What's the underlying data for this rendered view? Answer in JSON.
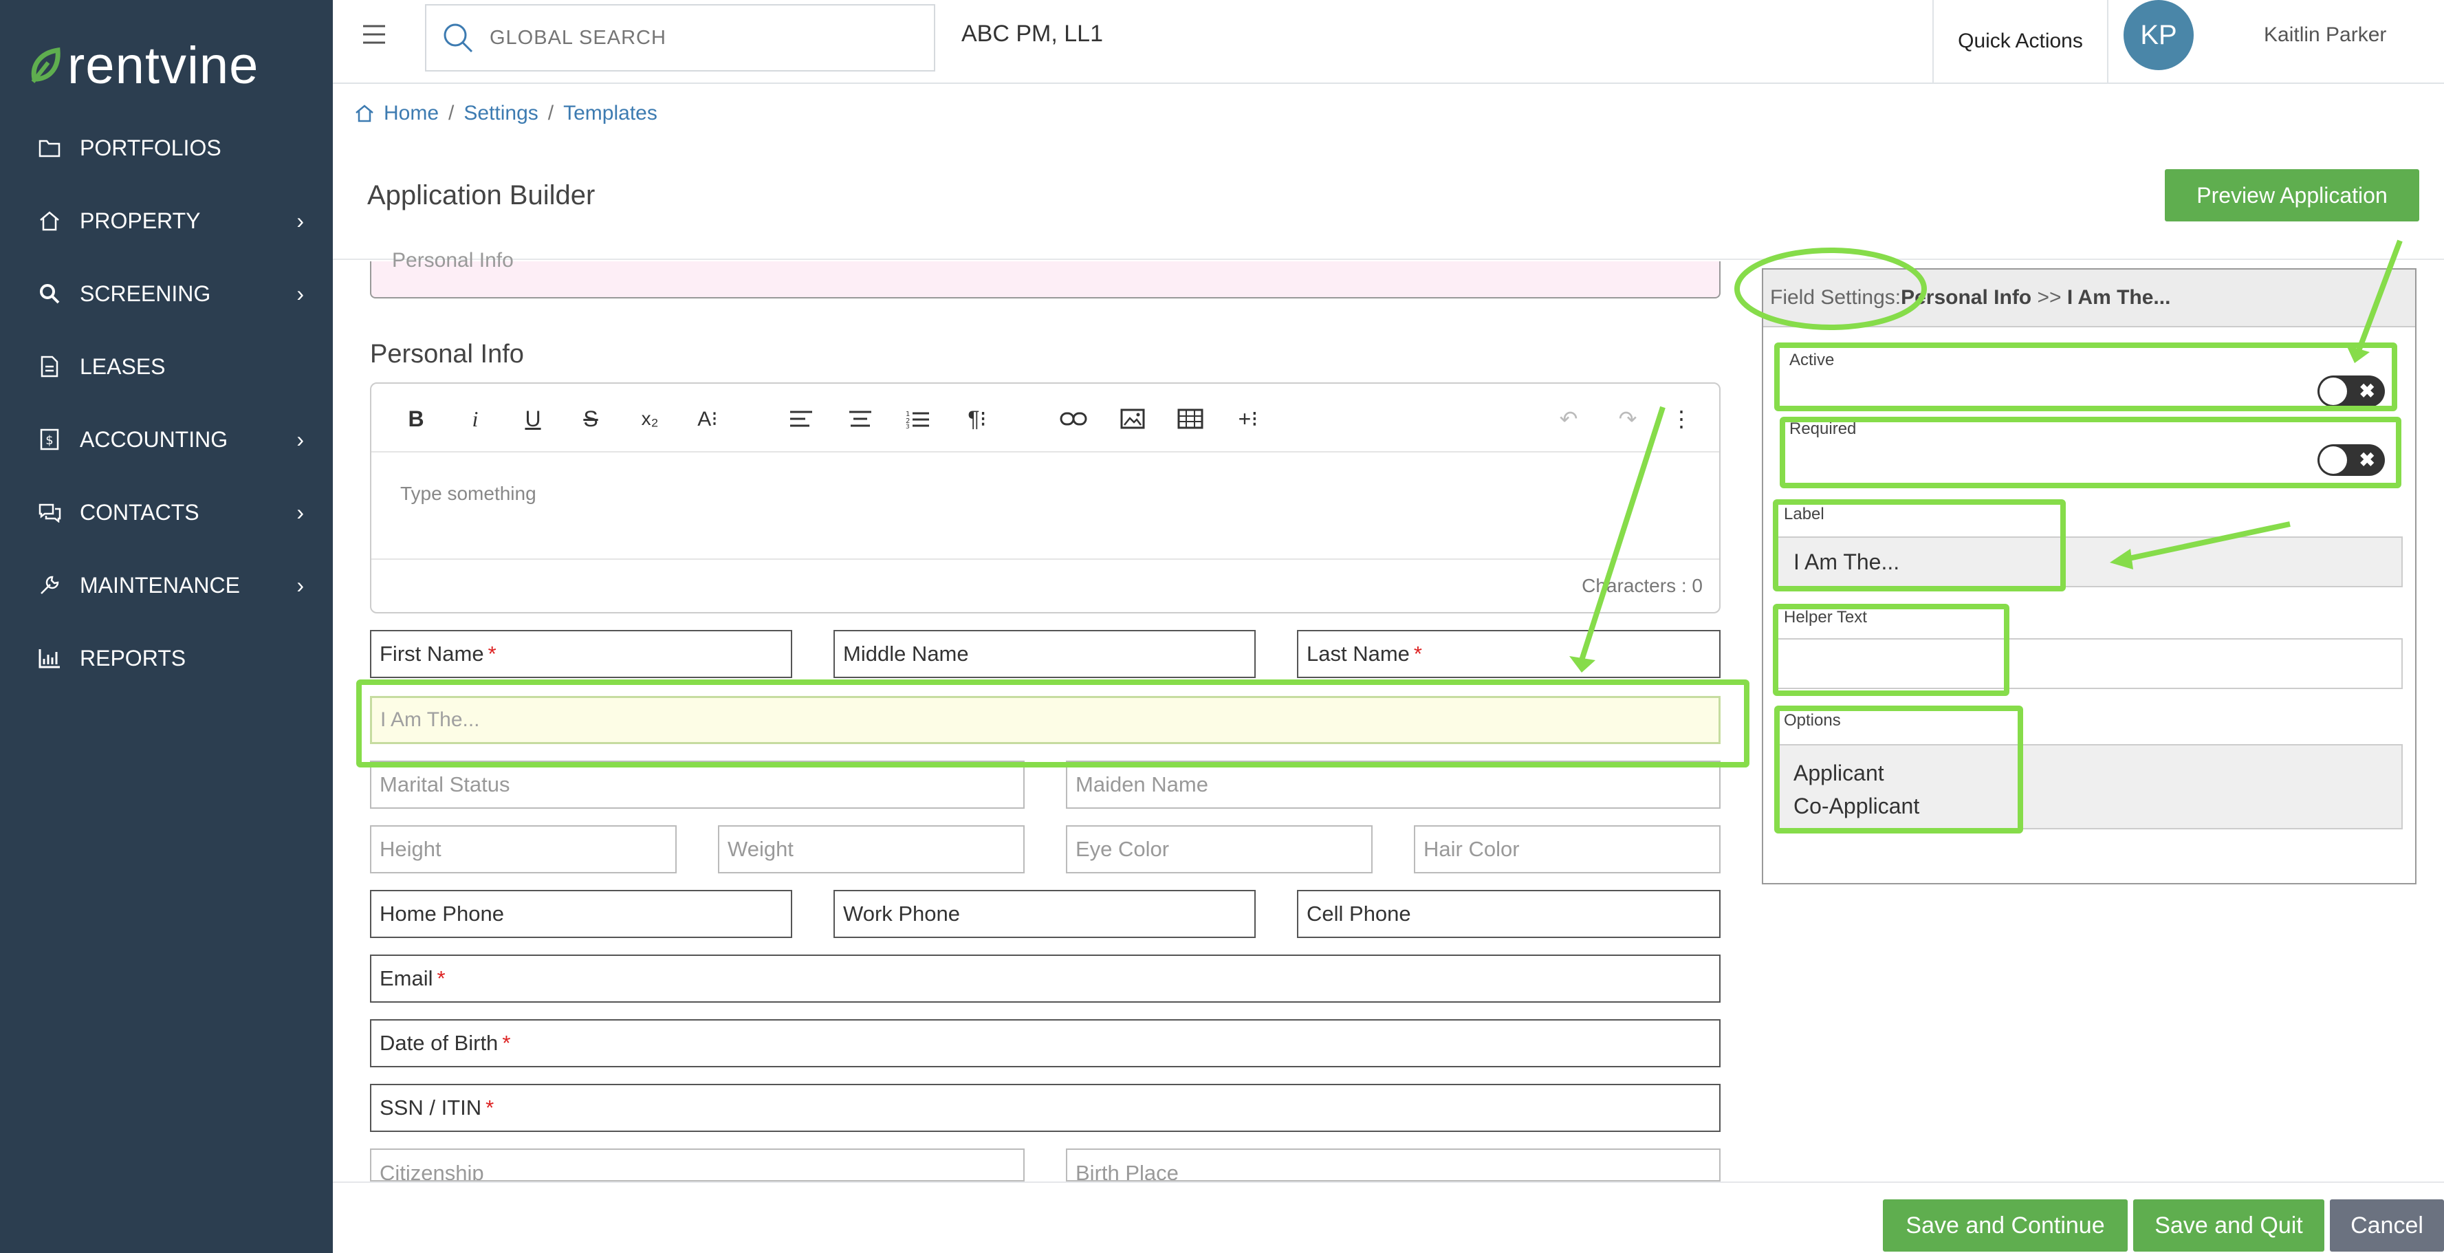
{
  "sidebar": {
    "logo": "rentvine",
    "items": [
      {
        "label": "PORTFOLIOS",
        "icon": "folder-icon",
        "chevron": false
      },
      {
        "label": "PROPERTY",
        "icon": "home-icon",
        "chevron": true
      },
      {
        "label": "SCREENING",
        "icon": "search-icon",
        "chevron": true
      },
      {
        "label": "LEASES",
        "icon": "document-icon",
        "chevron": false
      },
      {
        "label": "ACCOUNTING",
        "icon": "dollar-icon",
        "chevron": true
      },
      {
        "label": "CONTACTS",
        "icon": "chat-icon",
        "chevron": true
      },
      {
        "label": "MAINTENANCE",
        "icon": "wrench-icon",
        "chevron": true
      },
      {
        "label": "REPORTS",
        "icon": "chart-icon",
        "chevron": false
      }
    ],
    "chevron_glyph": "›"
  },
  "topbar": {
    "search_placeholder": "GLOBAL SEARCH",
    "company": "ABC PM, LL1",
    "quick_actions": "Quick Actions",
    "avatar_initials": "KP",
    "user_name": "Kaitlin Parker"
  },
  "breadcrumb": [
    "Home",
    "Settings",
    "Templates"
  ],
  "breadcrumb_sep": "/",
  "page": {
    "title": "Application Builder",
    "preview_button": "Preview Application"
  },
  "form": {
    "banner_text": "Personal Info",
    "section_title": "Personal Info",
    "editor": {
      "placeholder": "Type something",
      "char_count": "Characters : 0"
    },
    "fields": {
      "first_name": "First Name",
      "middle_name": "Middle Name",
      "last_name": "Last Name",
      "i_am_the": "I Am The...",
      "marital_status": "Marital Status",
      "maiden_name": "Maiden Name",
      "height": "Height",
      "weight": "Weight",
      "eye_color": "Eye Color",
      "hair_color": "Hair Color",
      "home_phone": "Home Phone",
      "work_phone": "Work Phone",
      "cell_phone": "Cell Phone",
      "email": "Email",
      "dob": "Date of Birth",
      "ssn": "SSN / ITIN",
      "citizenship": "Citizenship",
      "birth_place": "Birth Place"
    },
    "required_mark": "*"
  },
  "settings": {
    "head_prefix": "Field Settings: ",
    "head_section": "Personal Info",
    "head_sep": " >> ",
    "head_field": "I Am The...",
    "active_label": "Active",
    "required_label": "Required",
    "label_label": "Label",
    "label_value": "I Am The...",
    "helper_label": "Helper Text",
    "helper_value": "",
    "options_label": "Options",
    "options": [
      "Applicant",
      "Co-Applicant"
    ],
    "toggle_x": "✖"
  },
  "buttons": {
    "save_continue": "Save and Continue",
    "save_quit": "Save and Quit",
    "cancel": "Cancel"
  },
  "colors": {
    "sidebar_bg": "#2c3e50",
    "accent_green": "#5fae4f",
    "highlight_green": "#86dc4a",
    "link_blue": "#3d7bb1",
    "avatar_blue": "#4a86a8",
    "cancel_gray": "#6b7280"
  }
}
